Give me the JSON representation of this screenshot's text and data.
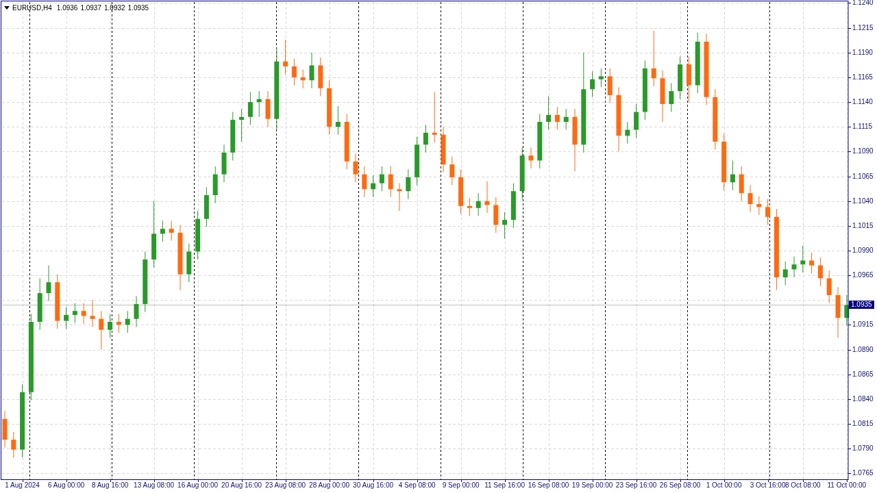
{
  "chart_header": {
    "symbol": "EURUSD,H4",
    "prices": [
      "1.0936",
      "1.0937",
      "1.0932",
      "1.0935"
    ]
  },
  "chart_data": {
    "type": "candlestick",
    "grid": true,
    "ylim": [
      1.0759,
      1.1241
    ],
    "categories": [
      null,
      null,
      "1 Aug 2024",
      null,
      null,
      null,
      null,
      "6 Aug 00:00",
      null,
      null,
      null,
      null,
      "8 Aug 16:00",
      null,
      null,
      null,
      null,
      "13 Aug 08:00",
      null,
      null,
      null,
      null,
      "16 Aug 00:00",
      null,
      null,
      null,
      null,
      "20 Aug 16:00",
      null,
      null,
      null,
      null,
      "23 Aug 08:00",
      null,
      null,
      null,
      null,
      "28 Aug 00:00",
      null,
      null,
      null,
      null,
      "30 Aug 16:00",
      null,
      null,
      null,
      null,
      "4 Sep 08:00",
      null,
      null,
      null,
      null,
      "9 Sep 00:00",
      null,
      null,
      null,
      null,
      "11 Sep 16:00",
      null,
      null,
      null,
      null,
      "16 Sep 08:00",
      null,
      null,
      null,
      null,
      "19 Sep 00:00",
      null,
      null,
      null,
      null,
      "23 Sep 16:00",
      null,
      null,
      null,
      null,
      "26 Sep 08:00",
      null,
      null,
      null,
      null,
      "1 Oct 00:00",
      null,
      null,
      null,
      null,
      "3 Oct 16:00",
      null,
      null,
      null,
      "8 Oct 08:00",
      null,
      null,
      null,
      null,
      "11 Oct 00:00"
    ],
    "ohlc": [
      [
        1.082,
        1.0828,
        1.0791,
        1.0799
      ],
      [
        1.0799,
        1.0807,
        1.0781,
        1.0789
      ],
      [
        1.0789,
        1.0855,
        1.0781,
        1.0847
      ],
      [
        1.0847,
        1.0926,
        1.0839,
        1.0918
      ],
      [
        1.0918,
        1.0962,
        1.091,
        1.0947
      ],
      [
        1.0947,
        1.0975,
        1.0939,
        1.0958
      ],
      [
        1.0958,
        1.0966,
        1.0911,
        1.0919
      ],
      [
        1.0919,
        1.0933,
        1.0911,
        1.0925
      ],
      [
        1.0925,
        1.0937,
        1.0917,
        1.0929
      ],
      [
        1.0929,
        1.0937,
        1.0916,
        1.0924
      ],
      [
        1.0924,
        1.094,
        1.0913,
        1.0921
      ],
      [
        1.0921,
        1.0929,
        1.089,
        1.091
      ],
      [
        1.091,
        1.0926,
        1.0902,
        1.0918
      ],
      [
        1.0918,
        1.0926,
        1.0907,
        1.0915
      ],
      [
        1.0915,
        1.0929,
        1.0907,
        1.0921
      ],
      [
        1.0921,
        1.0944,
        1.0913,
        1.0936
      ],
      [
        1.0936,
        1.0989,
        1.0928,
        1.0981
      ],
      [
        1.0981,
        1.104,
        1.0973,
        1.1007
      ],
      [
        1.1007,
        1.102,
        1.0999,
        1.1012
      ],
      [
        1.1012,
        1.102,
        1.1,
        1.1008
      ],
      [
        1.1008,
        1.1016,
        1.095,
        1.0966
      ],
      [
        1.0966,
        1.0997,
        1.0958,
        1.0989
      ],
      [
        1.0989,
        1.103,
        1.0981,
        1.1022
      ],
      [
        1.1022,
        1.1054,
        1.1014,
        1.1046
      ],
      [
        1.1046,
        1.1075,
        1.1038,
        1.1067
      ],
      [
        1.1067,
        1.1097,
        1.1059,
        1.1089
      ],
      [
        1.1089,
        1.113,
        1.1081,
        1.1122
      ],
      [
        1.1122,
        1.1133,
        1.11,
        1.1125
      ],
      [
        1.1125,
        1.115,
        1.1117,
        1.114
      ],
      [
        1.114,
        1.1151,
        1.1125,
        1.1143
      ],
      [
        1.1143,
        1.1151,
        1.1115,
        1.1123
      ],
      [
        1.1123,
        1.1195,
        1.1112,
        1.1181
      ],
      [
        1.1181,
        1.1203,
        1.1168,
        1.1176
      ],
      [
        1.1176,
        1.1184,
        1.1157,
        1.1165
      ],
      [
        1.1165,
        1.1173,
        1.1154,
        1.1162
      ],
      [
        1.1162,
        1.119,
        1.1154,
        1.1177
      ],
      [
        1.1177,
        1.1185,
        1.1146,
        1.1154
      ],
      [
        1.1154,
        1.1162,
        1.1107,
        1.1115
      ],
      [
        1.1115,
        1.1136,
        1.1107,
        1.112
      ],
      [
        1.112,
        1.1128,
        1.1072,
        1.108
      ],
      [
        1.108,
        1.1088,
        1.1059,
        1.1067
      ],
      [
        1.1067,
        1.1075,
        1.1044,
        1.1052
      ],
      [
        1.1052,
        1.1066,
        1.1044,
        1.1058
      ],
      [
        1.1058,
        1.1075,
        1.105,
        1.1067
      ],
      [
        1.1067,
        1.1075,
        1.1044,
        1.1052
      ],
      [
        1.1052,
        1.1058,
        1.103,
        1.105
      ],
      [
        1.105,
        1.1072,
        1.1042,
        1.1064
      ],
      [
        1.1064,
        1.1105,
        1.1056,
        1.1097
      ],
      [
        1.1097,
        1.1117,
        1.1089,
        1.1109
      ],
      [
        1.1109,
        1.115,
        1.1099,
        1.1107
      ],
      [
        1.1107,
        1.1115,
        1.1069,
        1.1077
      ],
      [
        1.1077,
        1.1085,
        1.1056,
        1.1064
      ],
      [
        1.1064,
        1.1072,
        1.1027,
        1.1035
      ],
      [
        1.1035,
        1.1043,
        1.1025,
        1.1033
      ],
      [
        1.1033,
        1.1048,
        1.1025,
        1.104
      ],
      [
        1.104,
        1.106,
        1.1028,
        1.1036
      ],
      [
        1.1036,
        1.1044,
        1.1008,
        1.1016
      ],
      [
        1.1016,
        1.1029,
        1.1002,
        1.1021
      ],
      [
        1.1021,
        1.1058,
        1.1013,
        1.105
      ],
      [
        1.105,
        1.1094,
        1.1042,
        1.1086
      ],
      [
        1.1086,
        1.1094,
        1.1073,
        1.1081
      ],
      [
        1.1081,
        1.1128,
        1.1073,
        1.112
      ],
      [
        1.112,
        1.1146,
        1.1112,
        1.1127
      ],
      [
        1.1127,
        1.1135,
        1.1112,
        1.112
      ],
      [
        1.112,
        1.1133,
        1.1112,
        1.1125
      ],
      [
        1.1125,
        1.1133,
        1.107,
        1.1097
      ],
      [
        1.1097,
        1.119,
        1.1089,
        1.1153
      ],
      [
        1.1153,
        1.1171,
        1.1145,
        1.1163
      ],
      [
        1.1163,
        1.1174,
        1.1155,
        1.1166
      ],
      [
        1.1166,
        1.1174,
        1.1139,
        1.1147
      ],
      [
        1.1147,
        1.1155,
        1.109,
        1.1106
      ],
      [
        1.1106,
        1.112,
        1.1098,
        1.1112
      ],
      [
        1.1112,
        1.1138,
        1.1104,
        1.113
      ],
      [
        1.113,
        1.1182,
        1.1122,
        1.1174
      ],
      [
        1.1174,
        1.1212,
        1.1156,
        1.1164
      ],
      [
        1.1164,
        1.1172,
        1.112,
        1.1138
      ],
      [
        1.1138,
        1.1159,
        1.113,
        1.1151
      ],
      [
        1.1151,
        1.1186,
        1.1143,
        1.1178
      ],
      [
        1.1178,
        1.1186,
        1.114,
        1.1157
      ],
      [
        1.1157,
        1.121,
        1.1149,
        1.1201
      ],
      [
        1.1201,
        1.1209,
        1.1137,
        1.1145
      ],
      [
        1.1145,
        1.1153,
        1.1092,
        1.11
      ],
      [
        1.11,
        1.1108,
        1.1051,
        1.1059
      ],
      [
        1.1059,
        1.1081,
        1.1051,
        1.1067
      ],
      [
        1.1067,
        1.1075,
        1.104,
        1.1048
      ],
      [
        1.1048,
        1.1056,
        1.1029,
        1.1037
      ],
      [
        1.1037,
        1.1045,
        1.1026,
        1.1034
      ],
      [
        1.1034,
        1.1042,
        1.1016,
        1.1024
      ],
      [
        1.1024,
        1.1032,
        1.095,
        1.0963
      ],
      [
        1.0963,
        1.0979,
        1.0955,
        1.0971
      ],
      [
        1.0971,
        1.0984,
        1.0963,
        1.0976
      ],
      [
        1.0976,
        1.0995,
        1.0968,
        1.098
      ],
      [
        1.098,
        1.0988,
        1.0967,
        1.0975
      ],
      [
        1.0975,
        1.0983,
        1.0954,
        1.0962
      ],
      [
        1.0962,
        1.097,
        1.0937,
        1.0945
      ],
      [
        1.0945,
        1.0953,
        1.0902,
        1.0922
      ],
      [
        1.0922,
        1.0945,
        1.0914,
        1.0935
      ]
    ],
    "yticks": [
      {
        "value": 1.124,
        "label": "1.1240"
      },
      {
        "value": 1.1215,
        "label": "1.1215"
      },
      {
        "value": 1.119,
        "label": "1.1190"
      },
      {
        "value": 1.1165,
        "label": "1.1165"
      },
      {
        "value": 1.114,
        "label": "1.1140"
      },
      {
        "value": 1.1115,
        "label": "1.1115"
      },
      {
        "value": 1.109,
        "label": "1.1090"
      },
      {
        "value": 1.1065,
        "label": "1.1065"
      },
      {
        "value": 1.104,
        "label": "1.1040"
      },
      {
        "value": 1.1015,
        "label": "1.1015"
      },
      {
        "value": 1.099,
        "label": "1.0990"
      },
      {
        "value": 1.0965,
        "label": "1.0965"
      },
      {
        "value": 1.0915,
        "label": "1.0915"
      },
      {
        "value": 1.089,
        "label": "1.0890"
      },
      {
        "value": 1.0865,
        "label": "1.0865"
      },
      {
        "value": 1.084,
        "label": "1.0840"
      },
      {
        "value": 1.0815,
        "label": "1.0815"
      },
      {
        "value": 1.079,
        "label": "1.0790"
      },
      {
        "value": 1.0765,
        "label": "1.0765"
      }
    ],
    "ref_lines": [
      {
        "axis": "y",
        "value": 1.0935,
        "label": "1.0935"
      }
    ]
  }
}
